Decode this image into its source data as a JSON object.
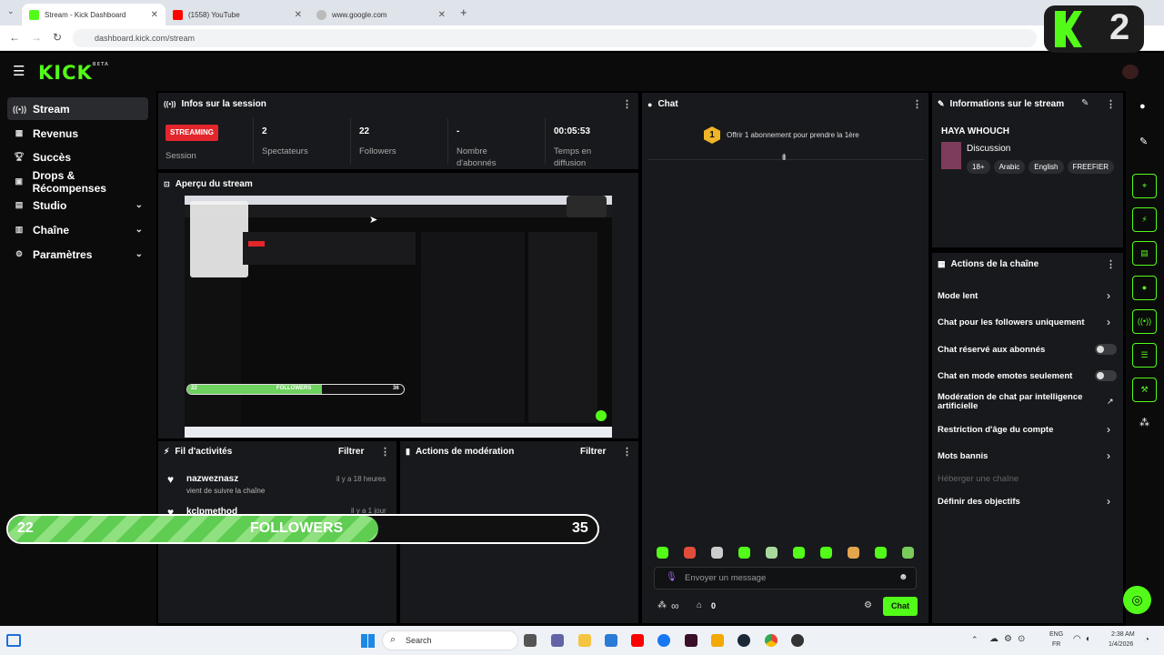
{
  "browser": {
    "tabs": [
      {
        "label": "Stream - Kick Dashboard",
        "active": true
      },
      {
        "label": "(1558) YouTube",
        "active": false
      },
      {
        "label": "www.google.com",
        "active": false
      }
    ],
    "url": "dashboard.kick.com/stream",
    "overlay_badge": "2"
  },
  "header": {
    "logo": "KICK",
    "logo_sup": "BETA"
  },
  "sidebar": {
    "items": [
      {
        "label": "Stream",
        "icon": "broadcast-icon"
      },
      {
        "label": "Revenus",
        "icon": "bar-chart-icon"
      },
      {
        "label": "Succès",
        "icon": "trophy-icon"
      },
      {
        "label": "Drops & Récompenses",
        "icon": "gift-icon"
      },
      {
        "label": "Studio",
        "icon": "grid-icon"
      },
      {
        "label": "Chaîne",
        "icon": "layout-icon"
      },
      {
        "label": "Paramètres",
        "icon": "gear-icon"
      }
    ]
  },
  "session": {
    "title": "Infos sur la session",
    "status_badge": "STREAMING",
    "status_label": "Session",
    "viewers_value": "2",
    "viewers_label": "Spectateurs",
    "followers_value": "22",
    "followers_label": "Followers",
    "subs_value": "-",
    "subs_label_1": "Nombre",
    "subs_label_2": "d'abonnés",
    "time_value": "00:05:53",
    "time_label_1": "Temps en",
    "time_label_2": "diffusion"
  },
  "preview": {
    "title": "Aperçu du stream",
    "bar_left": "22",
    "bar_mid": "FOLLOWERS",
    "bar_right": "36"
  },
  "activity": {
    "title": "Fil d'activités",
    "filter": "Filtrer",
    "items": [
      {
        "user": "nazweznasz",
        "time": "il y a 18 heures",
        "action": "vient de suivre la chaîne"
      },
      {
        "user": "kclpmethod",
        "time": "il y a 1 jour",
        "action": ""
      }
    ]
  },
  "moderation": {
    "title": "Actions de modération",
    "filter": "Filtrer"
  },
  "followers_bar": {
    "current": "22",
    "label": "FOLLOWERS",
    "goal": "35",
    "progress": 0.6286
  },
  "chat": {
    "title": "Chat",
    "promo_number": "1",
    "promo_text": "Offrir 1 abonnement pour prendre la 1ère",
    "placeholder": "Envoyer un message",
    "infinity_label": "∞",
    "store_count": "0",
    "send_label": "Chat"
  },
  "stream_info": {
    "title": "Informations sur le stream",
    "stream_title": "HAYA WHOUCH",
    "category": "Discussion",
    "tags": [
      "18+",
      "Arabic",
      "English",
      "FREEFIER"
    ]
  },
  "channel_actions": {
    "title": "Actions de la chaîne",
    "items": [
      {
        "label": "Mode lent",
        "control": "chevron"
      },
      {
        "label": "Chat pour les followers uniquement",
        "control": "chevron"
      },
      {
        "label": "Chat réservé aux abonnés",
        "control": "toggle"
      },
      {
        "label": "Chat en mode emotes seulement",
        "control": "toggle"
      },
      {
        "label": "Modération de chat par intelligence artificielle",
        "control": "external"
      },
      {
        "label": "Restriction d'âge du compte",
        "control": "chevron"
      },
      {
        "label": "Mots bannis",
        "control": "chevron"
      },
      {
        "label": "Héberger une chaîne",
        "control": "disabled"
      },
      {
        "label": "Définir des objectifs",
        "control": "chevron"
      }
    ]
  },
  "taskbar": {
    "search": "Search",
    "lang_1": "ENG",
    "lang_2": "FR",
    "time": "2:38 AM",
    "date": "1/4/2026"
  },
  "colors": {
    "accent": "#53fc18",
    "streaming": "#e2262c",
    "panel": "#18191c",
    "bg": "#0b0b0c"
  }
}
